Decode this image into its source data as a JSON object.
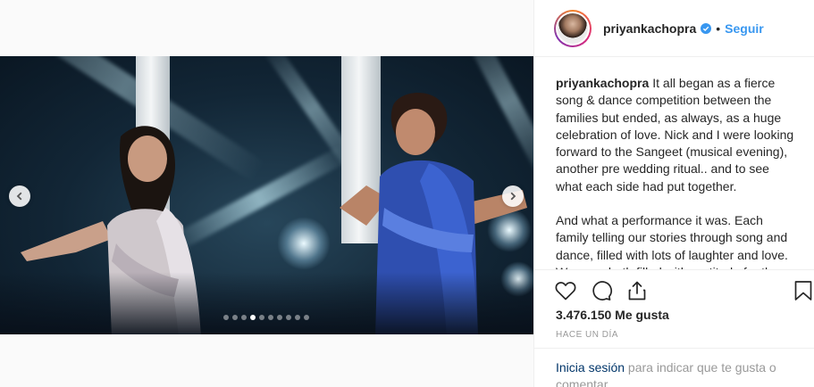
{
  "post": {
    "username": "priyankachopra",
    "separator": "•",
    "follow_label": "Seguir",
    "caption_paragraphs": [
      "It all began as a fierce song & dance competition between the families but ended, as always, as a huge celebration of love.  Nick and I were looking forward to the Sangeet (musical evening), another pre wedding ritual.. and to see what each side had put together.",
      "And what a performance it was. Each family telling our stories through song and dance, filled with lots of laughter and love. We were both filled with gratitude for the"
    ],
    "likes": "3.476.150 Me gusta",
    "timestamp": "HACE UN DÍA",
    "login_link": "Inicia sesión",
    "login_rest": " para indicar que te gusta o comentar."
  },
  "carousel": {
    "total_slides": 10,
    "active_index": 3
  },
  "icons": {
    "like": "heart-icon",
    "comment": "comment-icon",
    "share": "share-icon",
    "save": "bookmark-icon",
    "verified": "verified-badge-icon",
    "prev": "chevron-left-icon",
    "next": "chevron-right-icon"
  },
  "colors": {
    "accent": "#3897f0",
    "link": "#003569",
    "muted": "#999999"
  }
}
